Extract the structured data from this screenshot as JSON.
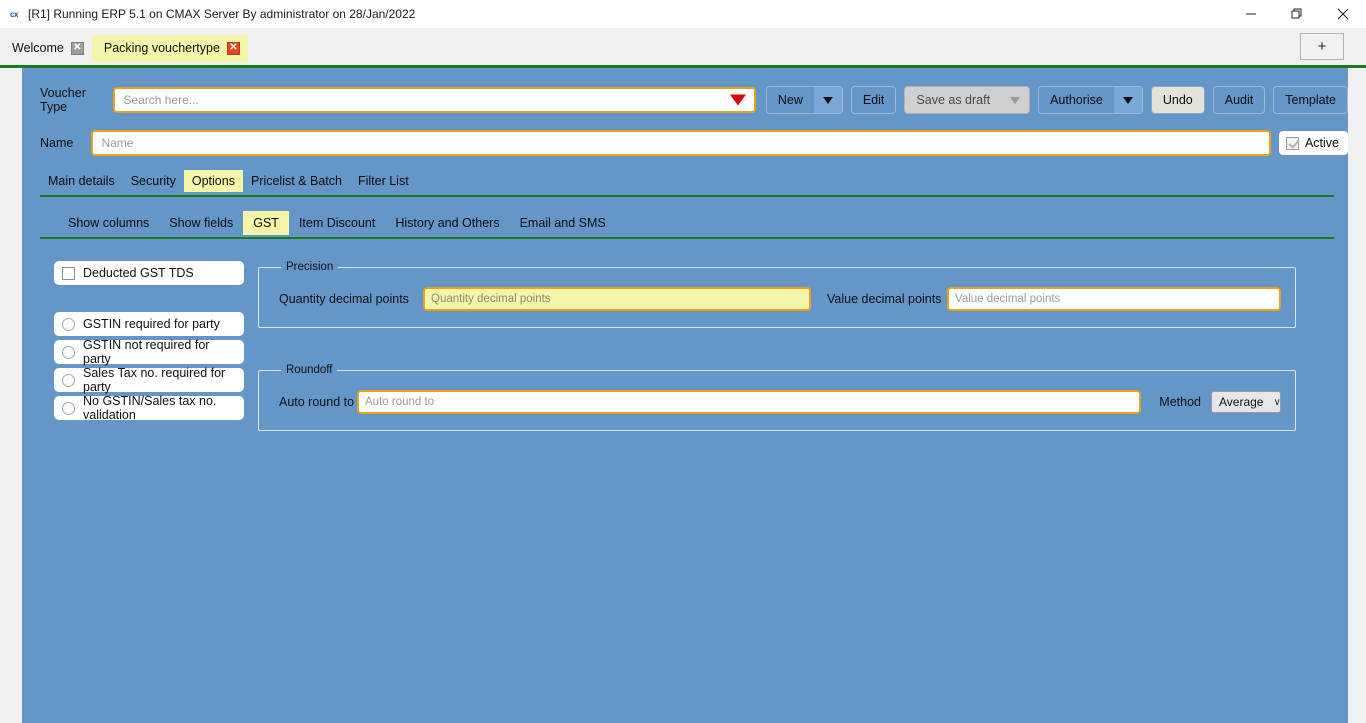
{
  "window": {
    "title": "[R1] Running ERP 5.1 on CMAX Server By administrator on 28/Jan/2022",
    "app_icon": "cx",
    "minimize": "—",
    "restore": "restore-icon",
    "close": "✕"
  },
  "tabstrip": {
    "tabs": [
      {
        "label": "Welcome",
        "close": "✕",
        "active": false
      },
      {
        "label": "Packing vouchertype",
        "close": "✕",
        "active": true
      }
    ],
    "new_tab": "+"
  },
  "form": {
    "voucher_type_label": "Voucher Type",
    "voucher_type_value": "",
    "voucher_type_placeholder": "Search here...",
    "name_label": "Name",
    "name_value": "",
    "name_placeholder": "Name",
    "active_label": "Active"
  },
  "toolbar": {
    "new_label": "New",
    "edit_label": "Edit",
    "save_as_draft_label": "Save as draft",
    "authorise_label": "Authorise",
    "undo_label": "Undo",
    "audit_label": "Audit",
    "template_label": "Template"
  },
  "main_tabs": [
    {
      "label": "Main details",
      "active": false
    },
    {
      "label": "Security",
      "active": false
    },
    {
      "label": "Options",
      "active": true
    },
    {
      "label": "Pricelist & Batch",
      "active": false
    },
    {
      "label": "Filter List",
      "active": false
    }
  ],
  "sub_tabs": [
    {
      "label": "Show columns",
      "active": false
    },
    {
      "label": "Show fields",
      "active": false
    },
    {
      "label": "GST",
      "active": true
    },
    {
      "label": "Item Discount",
      "active": false
    },
    {
      "label": "History and Others",
      "active": false
    },
    {
      "label": "Email and SMS",
      "active": false
    }
  ],
  "gst": {
    "deducted_gst_tds": "Deducted GST TDS",
    "validation_options": [
      "GSTIN required for party",
      "GSTIN not required for party",
      "Sales Tax no. required for party",
      "No GSTIN/Sales tax no. validation"
    ],
    "precision": {
      "legend": "Precision",
      "quantity_label": "Quantity decimal points",
      "quantity_value": "",
      "quantity_placeholder": "Quantity decimal points",
      "value_label": "Value decimal points",
      "value_value": "",
      "value_placeholder": "Value decimal points"
    },
    "roundoff": {
      "legend": "Roundoff",
      "auto_round_label": "Auto round to",
      "auto_round_value": "",
      "auto_round_placeholder": "Auto round to",
      "method_label": "Method",
      "method_value": "Average",
      "method_chevron": "∨"
    }
  },
  "colors": {
    "client_background": "#6496c8",
    "accent_border": "#e8a317",
    "highlight_yellow": "#f4f5a8",
    "rule_green": "#1b7a1b",
    "dropdown_red": "#d30a0a"
  }
}
